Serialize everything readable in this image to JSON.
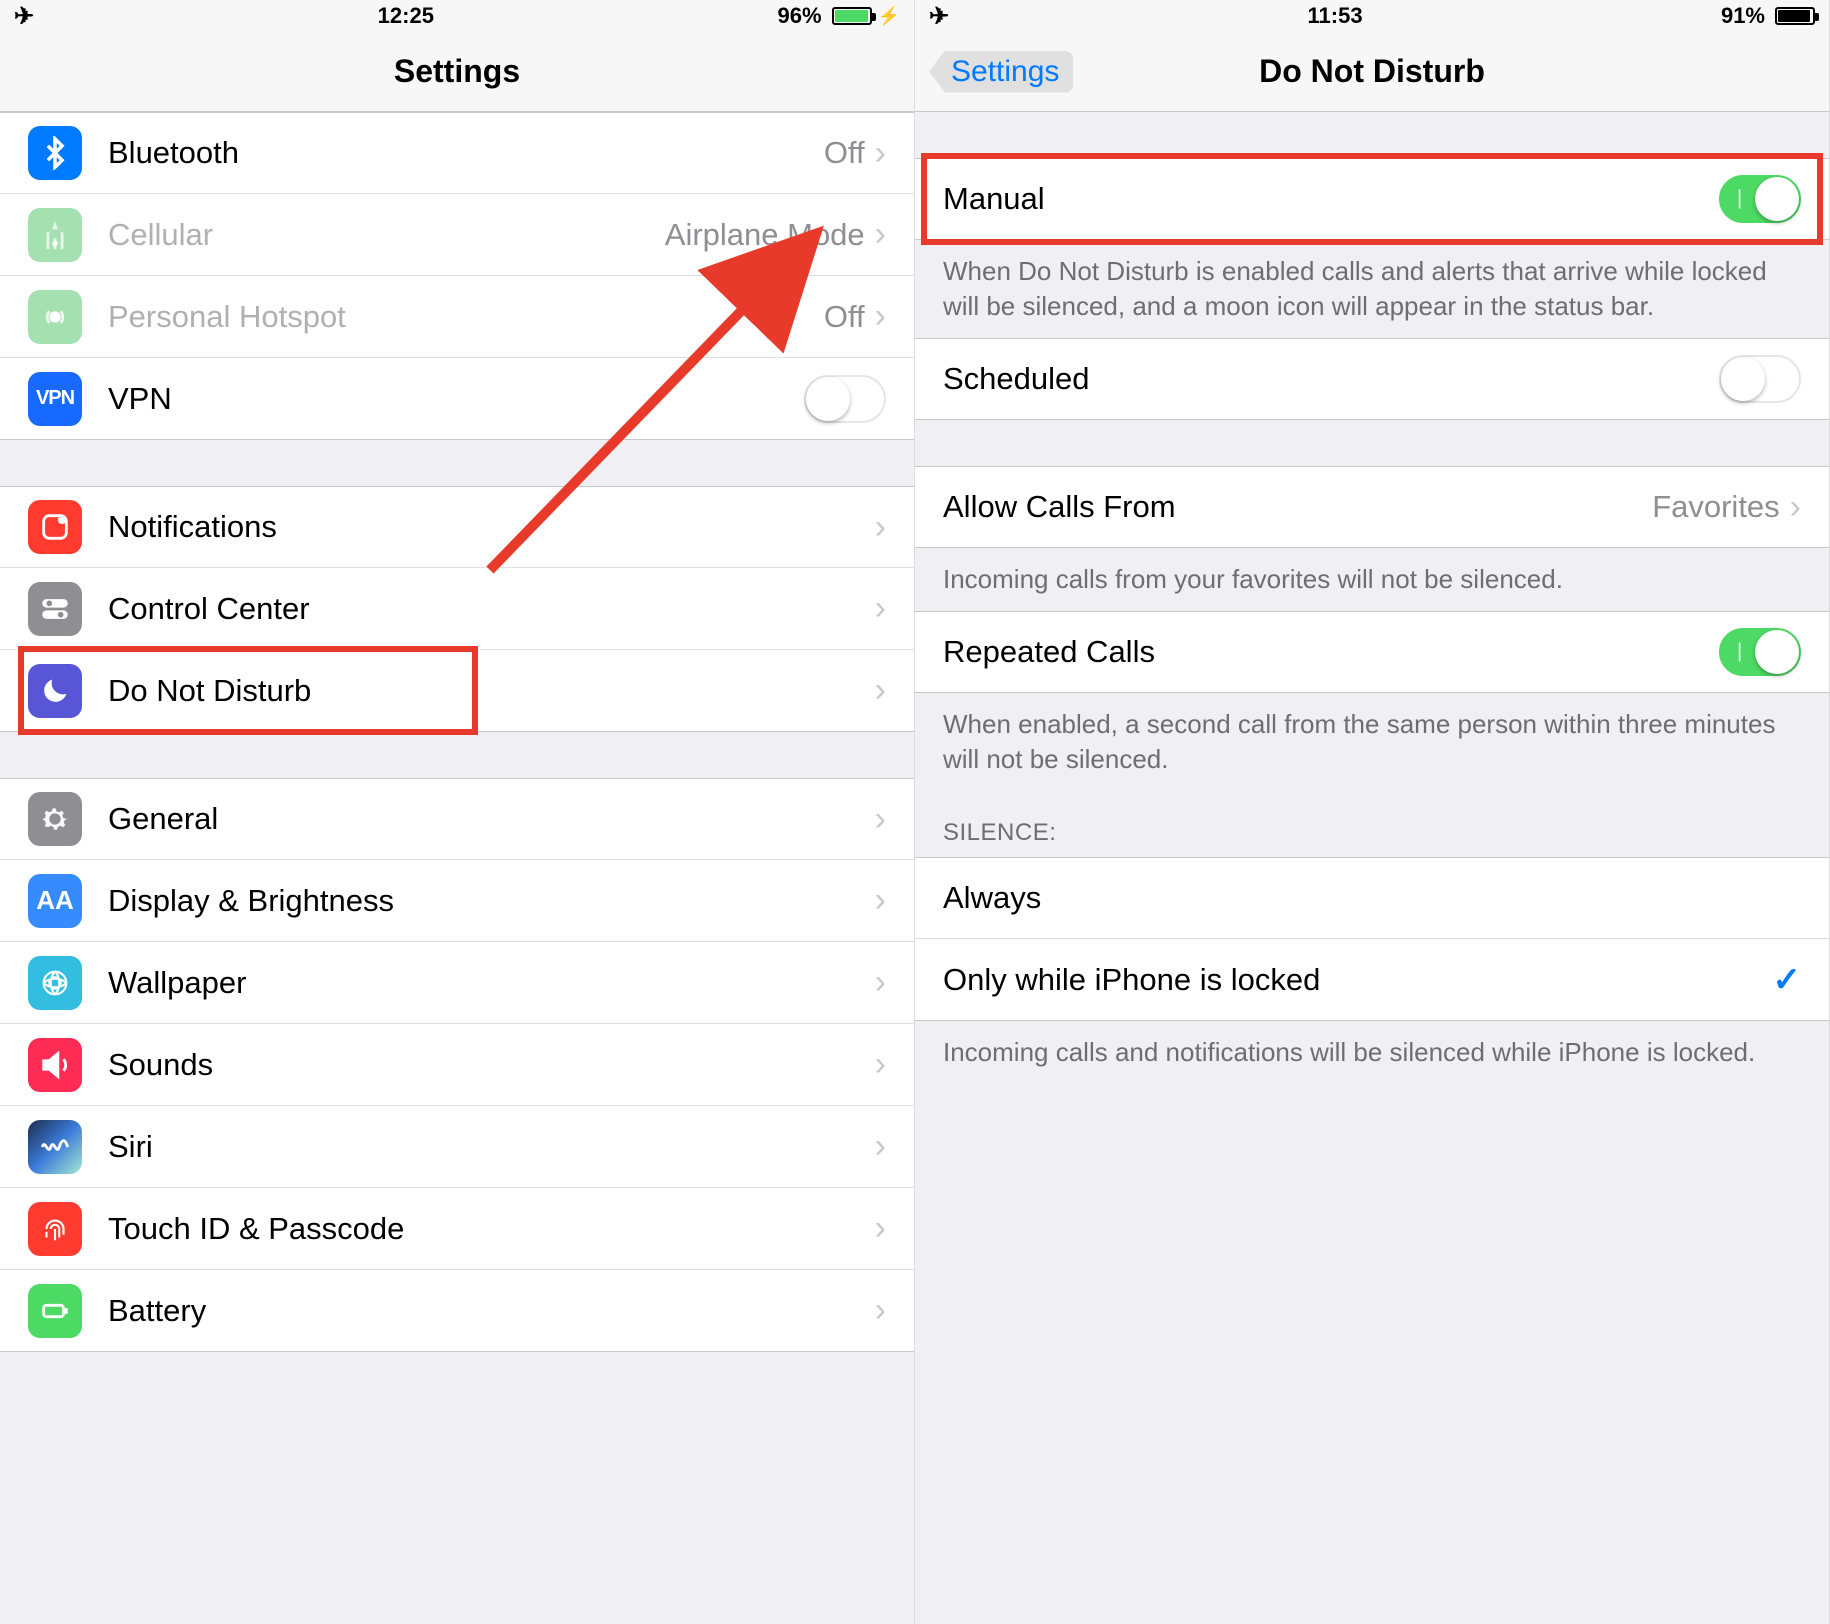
{
  "left": {
    "status": {
      "time": "12:25",
      "battery_pct": "96%",
      "battery_fill": 96,
      "charging": true,
      "battery_color": "green"
    },
    "nav": {
      "title": "Settings"
    },
    "groups": [
      {
        "rows": [
          {
            "id": "bluetooth",
            "icon": "bluetooth-icon",
            "iconClass": "bg-blue",
            "label": "Bluetooth",
            "value": "Off",
            "chevron": true
          },
          {
            "id": "cellular",
            "icon": "cellular-icon",
            "iconClass": "bg-lightgreen",
            "label": "Cellular",
            "value": "Airplane Mode",
            "chevron": true,
            "disabled": true
          },
          {
            "id": "hotspot",
            "icon": "hotspot-icon",
            "iconClass": "bg-green",
            "label": "Personal Hotspot",
            "value": "Off",
            "chevron": true,
            "disabled": true
          },
          {
            "id": "vpn",
            "icon": "vpn-icon",
            "iconClass": "bg-vpn",
            "label": "VPN",
            "toggle": true,
            "toggleOn": false
          }
        ]
      },
      {
        "rows": [
          {
            "id": "notifications",
            "icon": "notifications-icon",
            "iconClass": "bg-red",
            "label": "Notifications",
            "chevron": true
          },
          {
            "id": "control-center",
            "icon": "control-center-icon",
            "iconClass": "bg-gray",
            "label": "Control Center",
            "chevron": true
          },
          {
            "id": "dnd",
            "icon": "moon-icon",
            "iconClass": "bg-purple",
            "label": "Do Not Disturb",
            "chevron": true,
            "highlight": true
          }
        ]
      },
      {
        "rows": [
          {
            "id": "general",
            "icon": "gear-icon",
            "iconClass": "bg-darkgray",
            "label": "General",
            "chevron": true
          },
          {
            "id": "display",
            "icon": "display-icon",
            "iconClass": "bg-bright",
            "label": "Display & Brightness",
            "chevron": true
          },
          {
            "id": "wallpaper",
            "icon": "wallpaper-icon",
            "iconClass": "bg-teal",
            "label": "Wallpaper",
            "chevron": true
          },
          {
            "id": "sounds",
            "icon": "sounds-icon",
            "iconClass": "bg-sound",
            "label": "Sounds",
            "chevron": true
          },
          {
            "id": "siri",
            "icon": "siri-icon",
            "iconClass": "bg-siri",
            "label": "Siri",
            "chevron": true
          },
          {
            "id": "touchid",
            "icon": "touchid-icon",
            "iconClass": "bg-touch",
            "label": "Touch ID & Passcode",
            "chevron": true
          },
          {
            "id": "battery",
            "icon": "battery-icon",
            "iconClass": "bg-batt",
            "label": "Battery",
            "chevron": true
          }
        ]
      }
    ]
  },
  "right": {
    "status": {
      "time": "11:53",
      "battery_pct": "91%",
      "battery_fill": 91,
      "charging": false,
      "battery_color": "black"
    },
    "nav": {
      "back": "Settings",
      "title": "Do Not Disturb"
    },
    "sections": [
      {
        "rows": [
          {
            "id": "manual",
            "label": "Manual",
            "toggle": true,
            "toggleOn": true,
            "highlight": true
          }
        ],
        "footer": "When Do Not Disturb is enabled calls and alerts that arrive while locked will be silenced, and a moon icon will appear in the status bar."
      },
      {
        "rows": [
          {
            "id": "scheduled",
            "label": "Scheduled",
            "toggle": true,
            "toggleOn": false
          }
        ]
      },
      {
        "rows": [
          {
            "id": "allow-calls",
            "label": "Allow Calls From",
            "value": "Favorites",
            "chevron": true
          }
        ],
        "footer": "Incoming calls from your favorites will not be silenced."
      },
      {
        "rows": [
          {
            "id": "repeated-calls",
            "label": "Repeated Calls",
            "toggle": true,
            "toggleOn": true
          }
        ],
        "footer": "When enabled, a second call from the same person within three minutes will not be silenced."
      },
      {
        "header": "SILENCE:",
        "rows": [
          {
            "id": "always",
            "label": "Always"
          },
          {
            "id": "only-locked",
            "label": "Only while iPhone is locked",
            "checked": true
          }
        ],
        "footer": "Incoming calls and notifications will be silenced while iPhone is locked."
      }
    ]
  },
  "annotations": {
    "arrow": true
  }
}
